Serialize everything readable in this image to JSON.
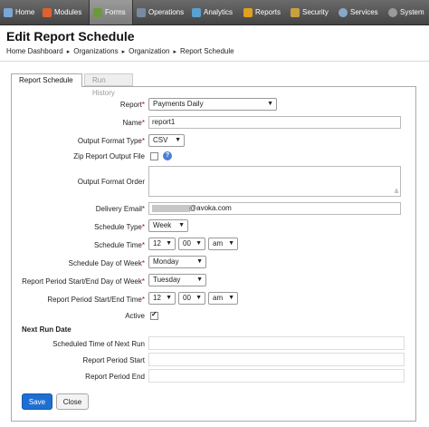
{
  "nav": {
    "items": [
      {
        "label": "Home",
        "icon": "home-icon",
        "color": "#7aa7d8"
      },
      {
        "label": "Modules",
        "icon": "modules-icon",
        "color": "#e06030"
      },
      {
        "label": "Forms",
        "icon": "forms-icon",
        "color": "#6a9a3a"
      },
      {
        "label": "Operations",
        "icon": "operations-icon",
        "color": "#7a8aa0"
      },
      {
        "label": "Analytics",
        "icon": "analytics-icon",
        "color": "#5aa0d0"
      },
      {
        "label": "Reports",
        "icon": "reports-icon",
        "color": "#e0a020"
      },
      {
        "label": "Security",
        "icon": "security-icon",
        "color": "#c8a040"
      },
      {
        "label": "Services",
        "icon": "services-icon",
        "color": "#8aa8c8"
      },
      {
        "label": "System",
        "icon": "system-icon",
        "color": "#9a9a9a"
      }
    ]
  },
  "page": {
    "title": "Edit Report Schedule"
  },
  "breadcrumb": [
    "Home Dashboard",
    "Organizations",
    "Organization",
    "Report Schedule"
  ],
  "tabs": {
    "active": "Report Schedule",
    "inactive": "Run History"
  },
  "form": {
    "report": {
      "label": "Report",
      "value": "Payments Daily"
    },
    "name": {
      "label": "Name",
      "value": "report1"
    },
    "output_format_type": {
      "label": "Output Format Type",
      "value": "CSV"
    },
    "zip_report": {
      "label": "Zip Report Output File"
    },
    "output_format_order": {
      "label": "Output Format Order"
    },
    "delivery_email": {
      "label": "Delivery Email",
      "value": "@avoka.com"
    },
    "schedule_type": {
      "label": "Schedule Type",
      "value": "Week"
    },
    "schedule_time": {
      "label": "Schedule Time",
      "hour": "12",
      "minute": "00",
      "ampm": "am"
    },
    "schedule_day": {
      "label": "Schedule Day of Week",
      "value": "Monday"
    },
    "period_start_end_day": {
      "label": "Report Period Start/End Day of Week",
      "value": "Tuesday"
    },
    "period_start_end_time": {
      "label": "Report Period Start/End Time",
      "hour": "12",
      "minute": "00",
      "ampm": "am"
    },
    "active": {
      "label": "Active"
    }
  },
  "next_run": {
    "heading": "Next Run Date",
    "scheduled_time": "Scheduled Time of Next Run",
    "period_start": "Report Period Start",
    "period_end": "Report Period End"
  },
  "buttons": {
    "save": "Save",
    "close": "Close"
  }
}
